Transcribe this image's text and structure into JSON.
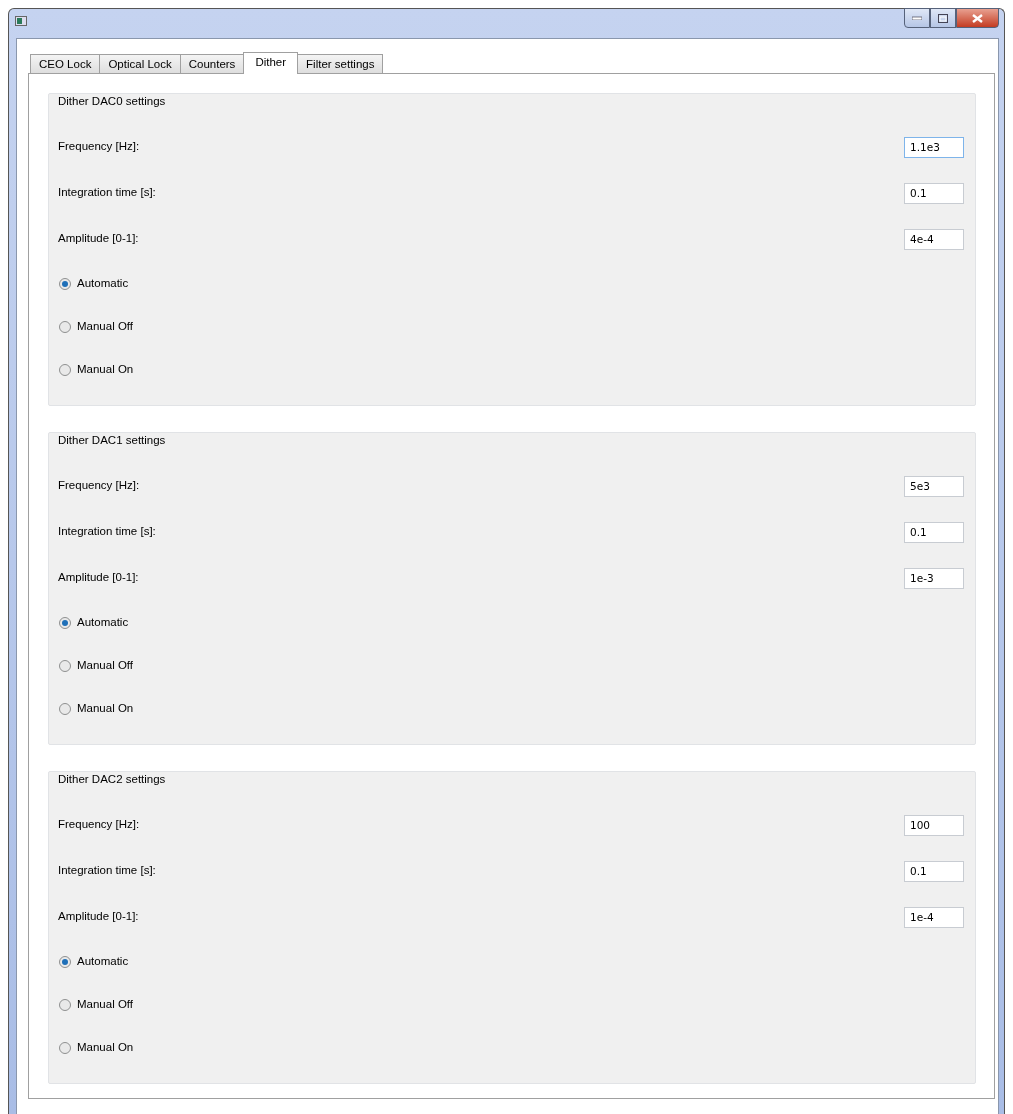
{
  "tabs": [
    {
      "label": "CEO Lock",
      "selected": false
    },
    {
      "label": "Optical Lock",
      "selected": false
    },
    {
      "label": "Counters",
      "selected": false
    },
    {
      "label": "Dither",
      "selected": true
    },
    {
      "label": "Filter settings",
      "selected": false
    }
  ],
  "groups": [
    {
      "title": "Dither DAC0 settings",
      "fields": [
        {
          "label": "Frequency [Hz]:",
          "value": "1.1e3",
          "focused": true
        },
        {
          "label": "Integration time [s]:",
          "value": "0.1",
          "focused": false
        },
        {
          "label": "Amplitude [0-1]:",
          "value": "4e-4",
          "focused": false
        }
      ],
      "radios": [
        {
          "label": "Automatic",
          "selected": true
        },
        {
          "label": "Manual Off",
          "selected": false
        },
        {
          "label": "Manual On",
          "selected": false
        }
      ]
    },
    {
      "title": "Dither DAC1 settings",
      "fields": [
        {
          "label": "Frequency [Hz]:",
          "value": "5e3",
          "focused": false
        },
        {
          "label": "Integration time [s]:",
          "value": "0.1",
          "focused": false
        },
        {
          "label": "Amplitude [0-1]:",
          "value": "1e-3",
          "focused": false
        }
      ],
      "radios": [
        {
          "label": "Automatic",
          "selected": true
        },
        {
          "label": "Manual Off",
          "selected": false
        },
        {
          "label": "Manual On",
          "selected": false
        }
      ]
    },
    {
      "title": "Dither DAC2 settings",
      "fields": [
        {
          "label": "Frequency [Hz]:",
          "value": "100",
          "focused": false
        },
        {
          "label": "Integration time [s]:",
          "value": "0.1",
          "focused": false
        },
        {
          "label": "Amplitude [0-1]:",
          "value": "1e-4",
          "focused": false
        }
      ],
      "radios": [
        {
          "label": "Automatic",
          "selected": true
        },
        {
          "label": "Manual Off",
          "selected": false
        },
        {
          "label": "Manual On",
          "selected": false
        }
      ]
    }
  ]
}
